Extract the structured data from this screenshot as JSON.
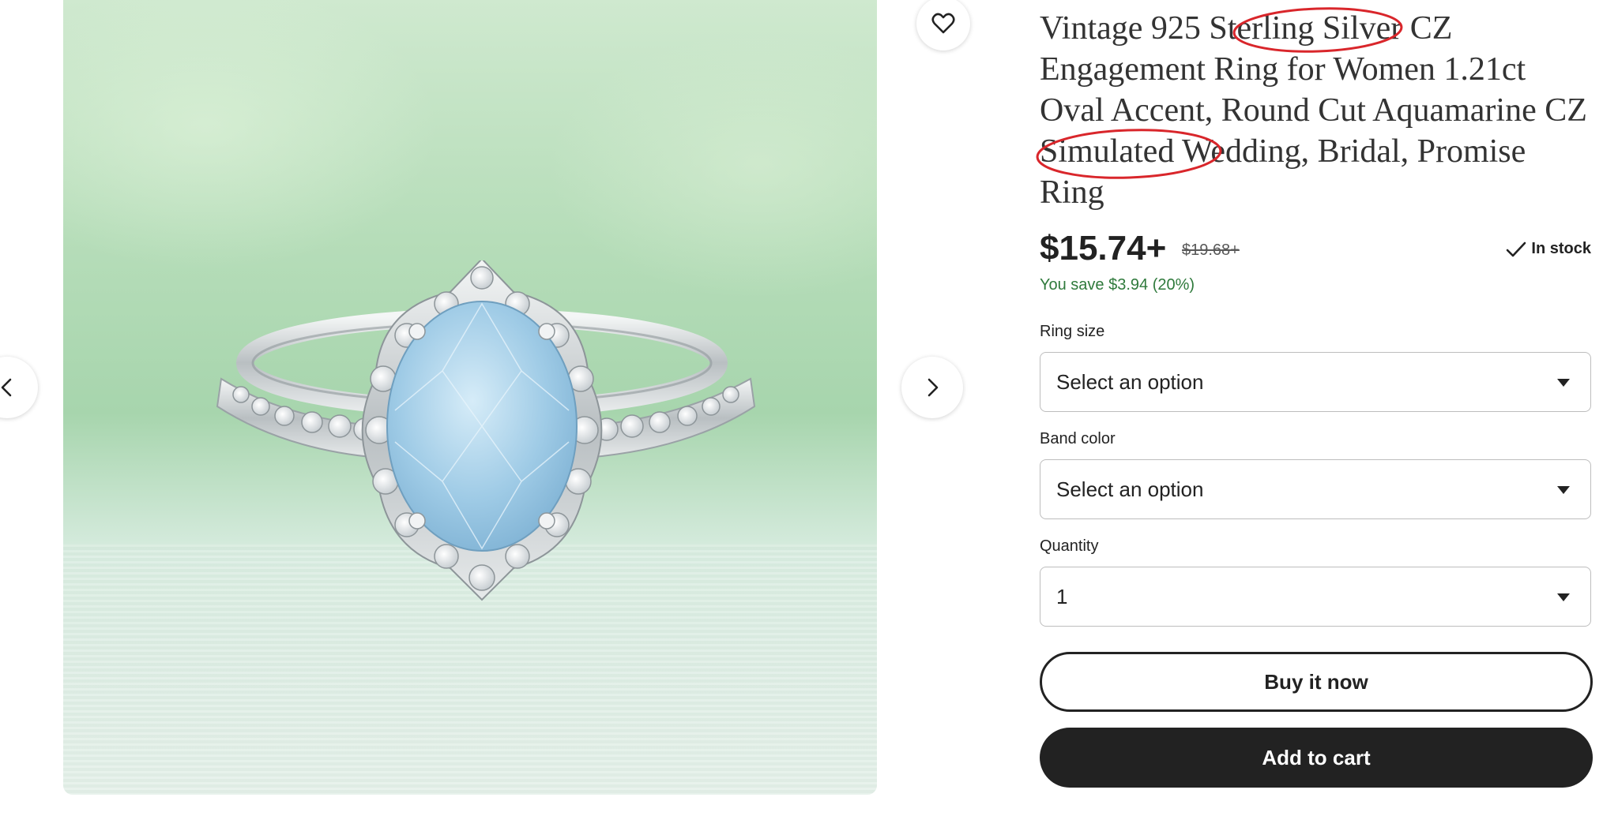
{
  "product": {
    "title": "Vintage 925 Sterling Silver CZ Engagement Ring for Women 1.21ct Oval Accent, Round Cut Aquamarine CZ Simulated Wedding, Bridal, Promise Ring",
    "price": "$15.74+",
    "original_price": "$19.68+",
    "savings": "You save $3.94 (20%)",
    "stock": "In stock"
  },
  "options": {
    "ring_size": {
      "label": "Ring size",
      "value": "Select an option"
    },
    "band_color": {
      "label": "Band color",
      "value": "Select an option"
    },
    "quantity": {
      "label": "Quantity",
      "value": "1"
    }
  },
  "actions": {
    "buy_now": "Buy it now",
    "add_to_cart": "Add to cart"
  },
  "icons": {
    "favorite": "heart-icon",
    "previous": "chevron-left-icon",
    "next": "chevron-right-icon",
    "stock": "check-icon",
    "dropdown": "caret-down-icon"
  },
  "colors": {
    "savings_text": "#2f7a3c",
    "primary_button": "#222222",
    "annotation": "#d9262b"
  }
}
